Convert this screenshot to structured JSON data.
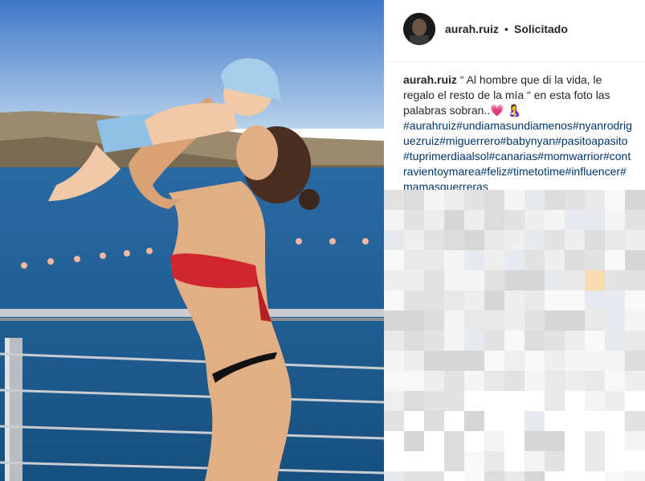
{
  "post": {
    "username": "aurah.ruiz",
    "separator": "•",
    "follow_status": "Solicitado",
    "caption_user": "aurah.ruiz",
    "caption_text": " “ Al hombre que di la vida, le regalo el resto de la mía “ en esta foto las palabras sobran..💗 🤱",
    "hashtags": "#aurahruiz#undiamasundiamenos#nyanrodriguezruiz#miguerrero#babynyan#pasitoapasito#tuprimerdiaalsol#canarias#momwarrior#contravientoymarea#feliz#timetotime#influencer#mamasguerreras"
  },
  "colors": {
    "hashtag": "#003569",
    "sky_top": "#3f78c8",
    "sea": "#1d5d93"
  }
}
